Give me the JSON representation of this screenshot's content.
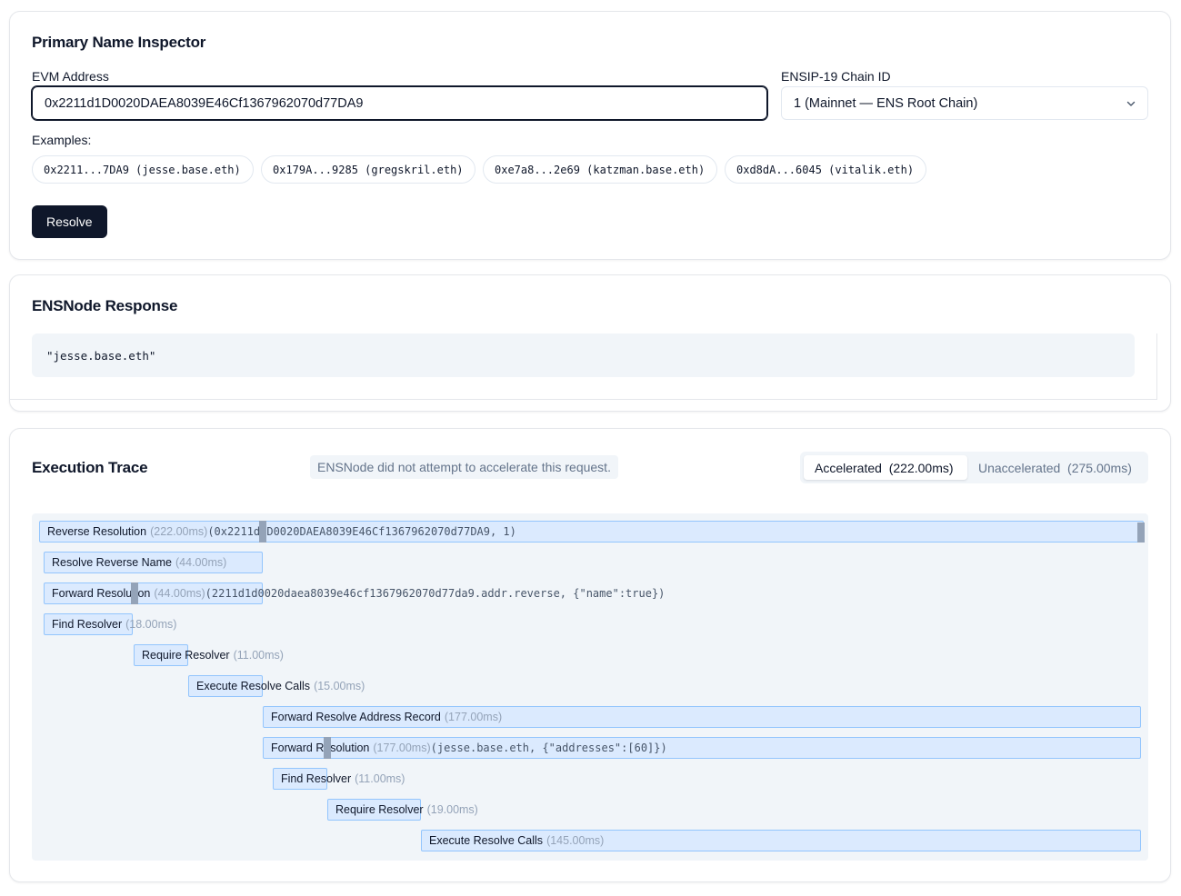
{
  "inspector": {
    "title": "Primary Name Inspector",
    "address_label": "EVM Address",
    "address_value": "0x2211d1D0020DAEA8039E46Cf1367962070d77DA9",
    "chain_label": "ENSIP-19 Chain ID",
    "chain_value": "1 (Mainnet — ENS Root Chain)",
    "examples_label": "Examples:",
    "examples": [
      "0x2211...7DA9 (jesse.base.eth)",
      "0x179A...9285 (gregskril.eth)",
      "0xe7a8...2e69 (katzman.base.eth)",
      "0xd8dA...6045 (vitalik.eth)"
    ],
    "resolve_label": "Resolve"
  },
  "response": {
    "title": "ENSNode Response",
    "value": "\"jesse.base.eth\""
  },
  "trace": {
    "title": "Execution Trace",
    "notice": "ENSNode did not attempt to accelerate this request.",
    "accelerated_label": "Accelerated  (222.00ms)",
    "unaccelerated_label": "Unaccelerated  (275.00ms)",
    "spans": [
      {
        "name": "Reverse Resolution",
        "duration": "(222.00ms)",
        "args": "(0x2211d1D0020DAEA8039E46Cf1367962070d77DA9, 1)"
      },
      {
        "name": "Resolve Reverse Name",
        "duration": "(44.00ms)",
        "args": ""
      },
      {
        "name": "Forward Resolution",
        "duration": "(44.00ms)",
        "args": "(2211d1d0020daea8039e46cf1367962070d77da9.addr.reverse, {\"name\":true})"
      },
      {
        "name": "Find Resolver",
        "duration": "(18.00ms)",
        "args": ""
      },
      {
        "name": "Require Resolver",
        "duration": "(11.00ms)",
        "args": ""
      },
      {
        "name": "Execute Resolve Calls",
        "duration": "(15.00ms)",
        "args": ""
      },
      {
        "name": "Forward Resolve Address Record",
        "duration": "(177.00ms)",
        "args": ""
      },
      {
        "name": "Forward Resolution",
        "duration": "(177.00ms)",
        "args": "(jesse.base.eth, {\"addresses\":[60]})"
      },
      {
        "name": "Find Resolver",
        "duration": "(11.00ms)",
        "args": ""
      },
      {
        "name": "Require Resolver",
        "duration": "(19.00ms)",
        "args": ""
      },
      {
        "name": "Execute Resolve Calls",
        "duration": "(145.00ms)",
        "args": ""
      }
    ]
  }
}
